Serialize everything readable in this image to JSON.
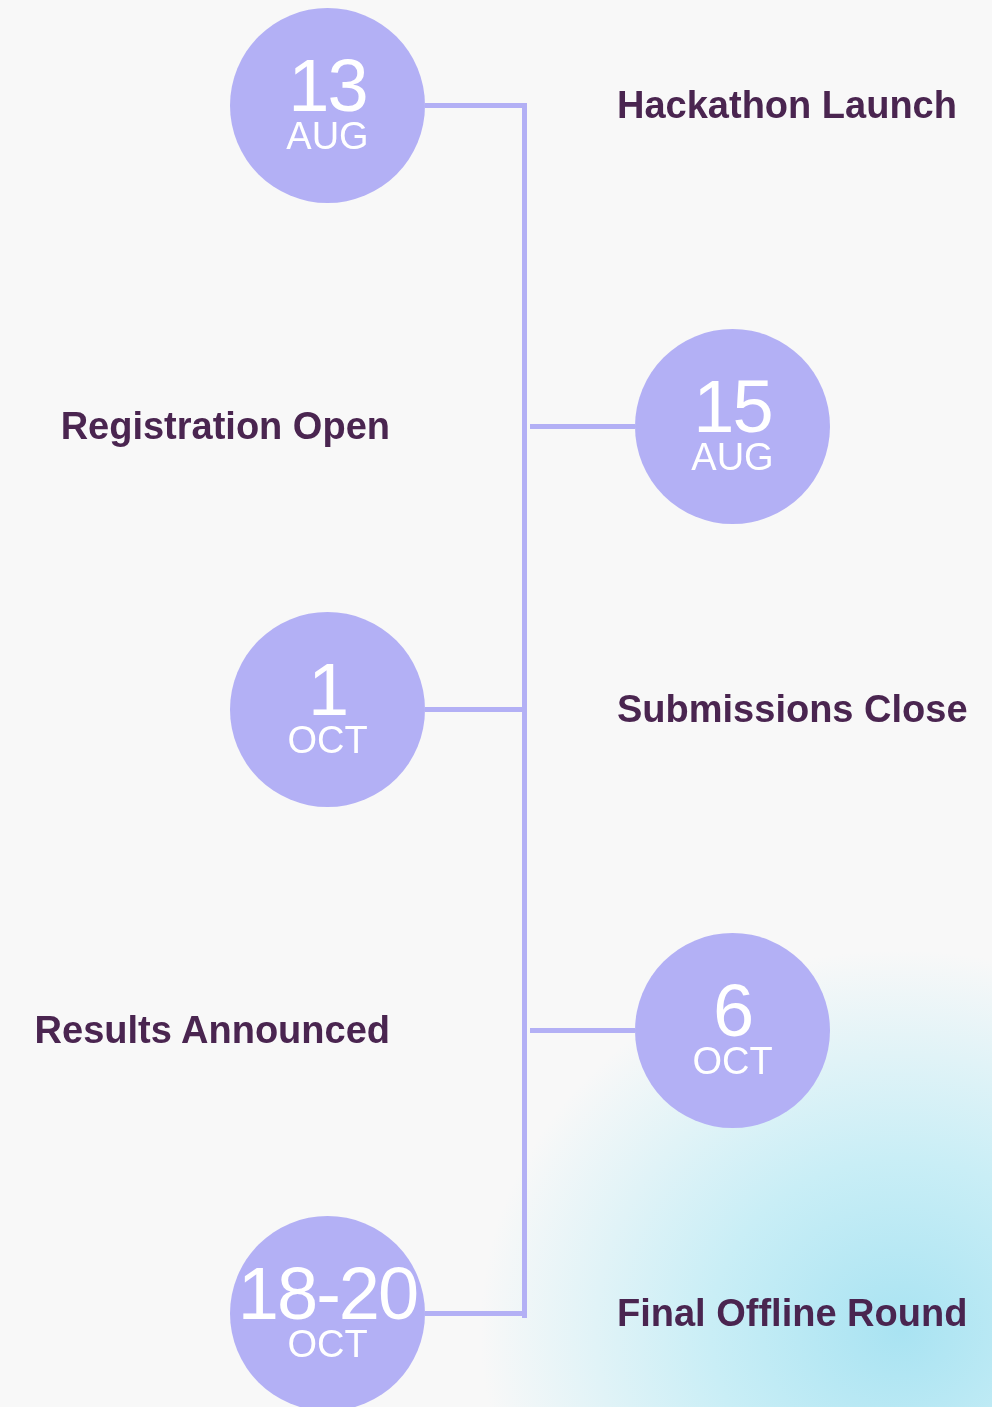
{
  "events": [
    {
      "day": "13",
      "month": "AUG",
      "title": "Hackathon Launch",
      "kind": "left"
    },
    {
      "day": "15",
      "month": "AUG",
      "title": "Registration Open",
      "kind": "right"
    },
    {
      "day": "1",
      "month": "OCT",
      "title": "Submissions Close",
      "kind": "left"
    },
    {
      "day": "6",
      "month": "OCT",
      "title": "Results Announced",
      "kind": "right"
    },
    {
      "day": "18-20",
      "month": "OCT",
      "title": "Final Offline Round",
      "kind": "left"
    }
  ]
}
